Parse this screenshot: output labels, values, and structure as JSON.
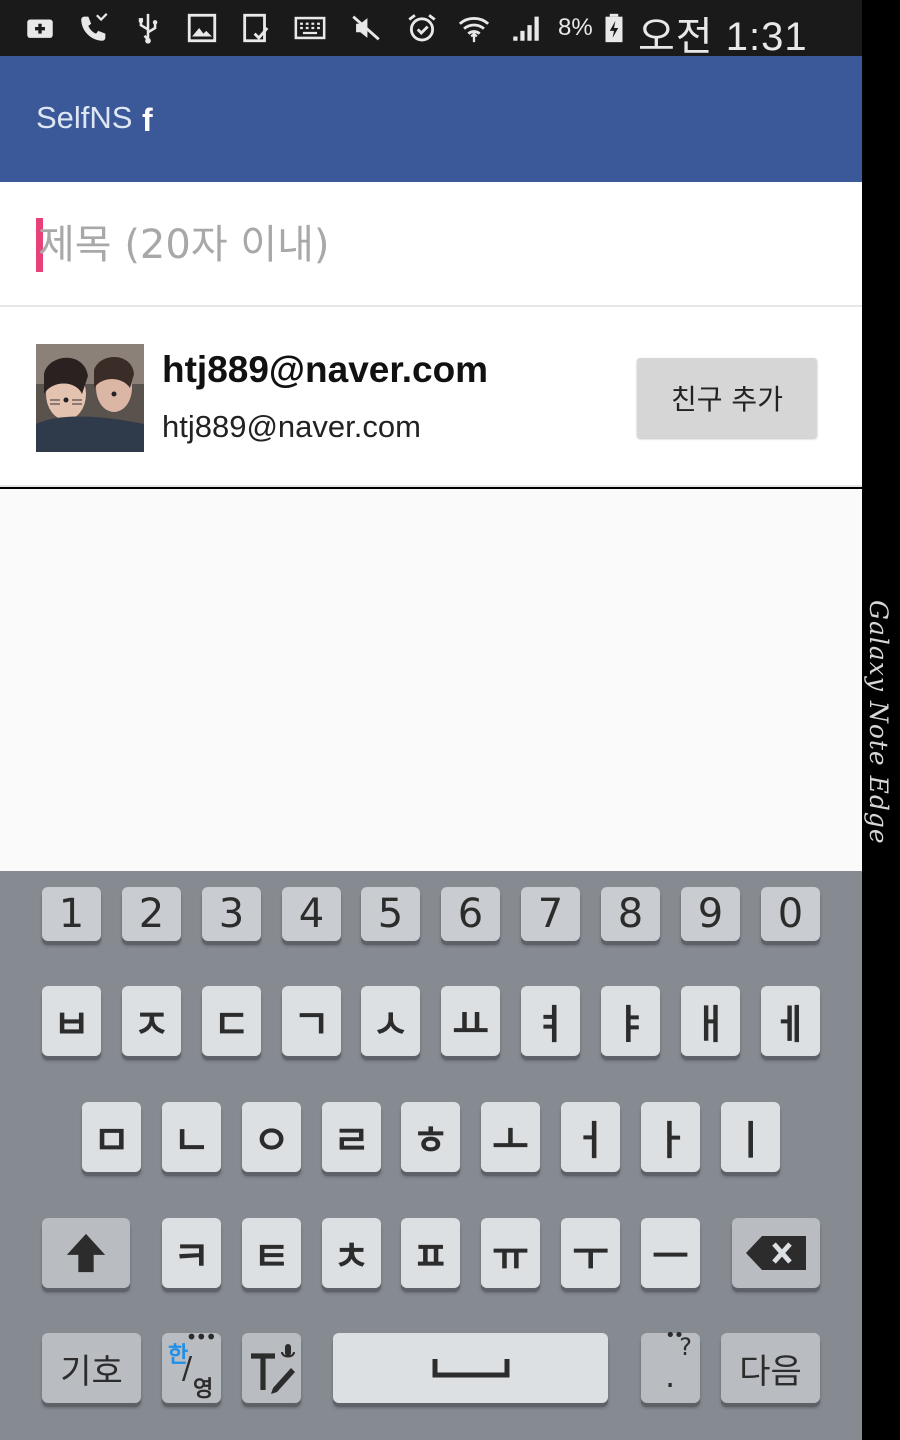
{
  "status_bar": {
    "icons": [
      "add-box-icon",
      "missed-call-icon",
      "usb-icon",
      "image-icon",
      "screenshot-icon",
      "keyboard-icon",
      "mute-icon",
      "alarm-icon",
      "wifi-icon",
      "signal-icon",
      "battery-charging-icon"
    ],
    "battery_percent": "8%",
    "time": "오전 1:31"
  },
  "app_bar": {
    "title": "SelfNS",
    "brand_icon": "f",
    "color": "#3b5998"
  },
  "title_input": {
    "placeholder": "제목 (20자 이내)",
    "value": ""
  },
  "friend": {
    "name": "htj889@naver.com",
    "email": "htj889@naver.com",
    "add_button_label": "친구 추가"
  },
  "keyboard": {
    "number_row": [
      "1",
      "2",
      "3",
      "4",
      "5",
      "6",
      "7",
      "8",
      "9",
      "0"
    ],
    "row1": [
      "ㅂ",
      "ㅈ",
      "ㄷ",
      "ㄱ",
      "ㅅ",
      "ㅛ",
      "ㅕ",
      "ㅑ",
      "ㅐ",
      "ㅔ"
    ],
    "row2": [
      "ㅁ",
      "ㄴ",
      "ㅇ",
      "ㄹ",
      "ㅎ",
      "ㅗ",
      "ㅓ",
      "ㅏ",
      "ㅣ"
    ],
    "row3": [
      "ㅋ",
      "ㅌ",
      "ㅊ",
      "ㅍ",
      "ㅠ",
      "ㅜ",
      "ㅡ"
    ],
    "symbol_label": "기호",
    "lang_top": "한",
    "lang_bottom": "영",
    "punct_top": "?",
    "punct_bottom": ".",
    "next_label": "다음"
  },
  "edge_panel": {
    "label": "Galaxy Note Edge"
  }
}
